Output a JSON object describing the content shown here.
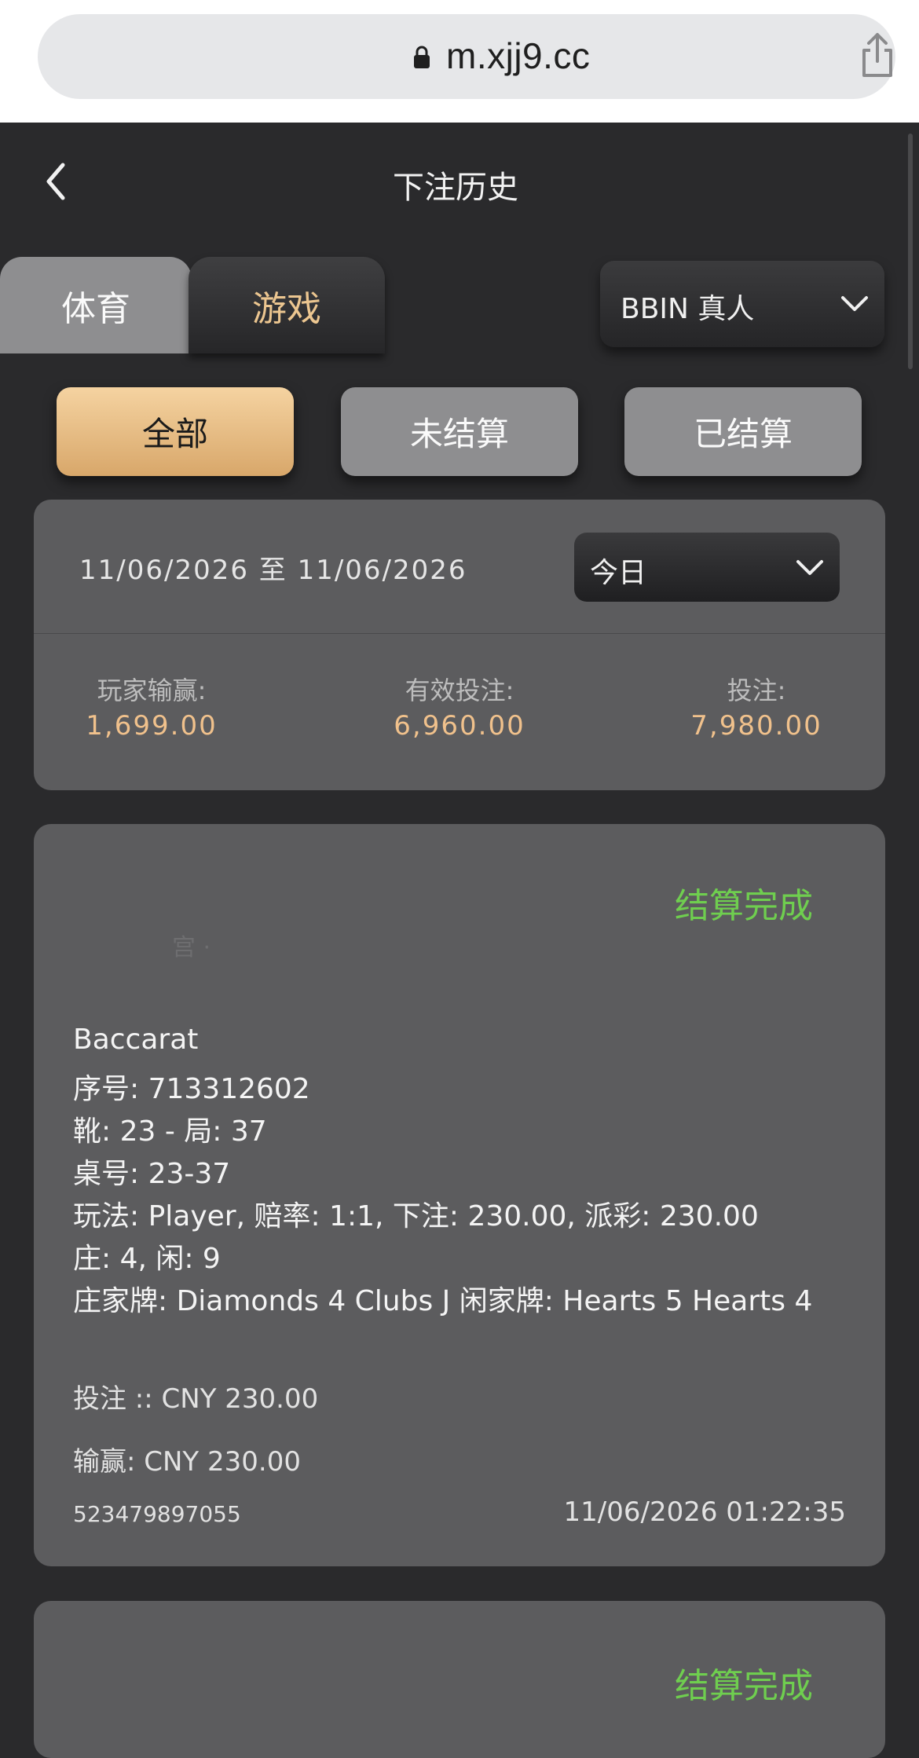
{
  "browser": {
    "url": "m.xjj9.cc"
  },
  "header": {
    "title": "下注历史"
  },
  "tabs": [
    {
      "label": "体育"
    },
    {
      "label": "游戏"
    }
  ],
  "platform_select": {
    "selected": "BBIN 真人"
  },
  "filters": [
    {
      "label": "全部"
    },
    {
      "label": "未结算"
    },
    {
      "label": "已结算"
    }
  ],
  "summary": {
    "date_range": "11/06/2026 至 11/06/2026",
    "period": "今日",
    "stats": [
      {
        "label": "玩家输赢:",
        "value": "1,699.00"
      },
      {
        "label": "有效投注:",
        "value": "6,960.00"
      },
      {
        "label": "投注:",
        "value": "7,980.00"
      }
    ]
  },
  "bets": [
    {
      "status": "结算完成",
      "faint_text": "宫 ·",
      "game": "Baccarat",
      "serial": "序号: 713312602",
      "shoe_round": "靴: 23 - 局: 37",
      "table": "桌号: 23-37",
      "play": "玩法: Player, 赔率: 1:1, 下注: 230.00, 派彩: 230.00",
      "score": "庄: 4, 闲: 9",
      "cards": "庄家牌: Diamonds 4 Clubs J 闲家牌: Hearts 5 Hearts 4",
      "stake": "投注 :: CNY  230.00",
      "winloss": "输赢: CNY 230.00",
      "bet_id": "523479897055",
      "time": "11/06/2026 01:22:35"
    },
    {
      "status": "结算完成"
    }
  ],
  "colors": {
    "accent_gold": "#f0c18c",
    "settled_green": "#6fce4f",
    "card_bg": "#5c5c5e",
    "page_bg": "#2a2a2c"
  }
}
